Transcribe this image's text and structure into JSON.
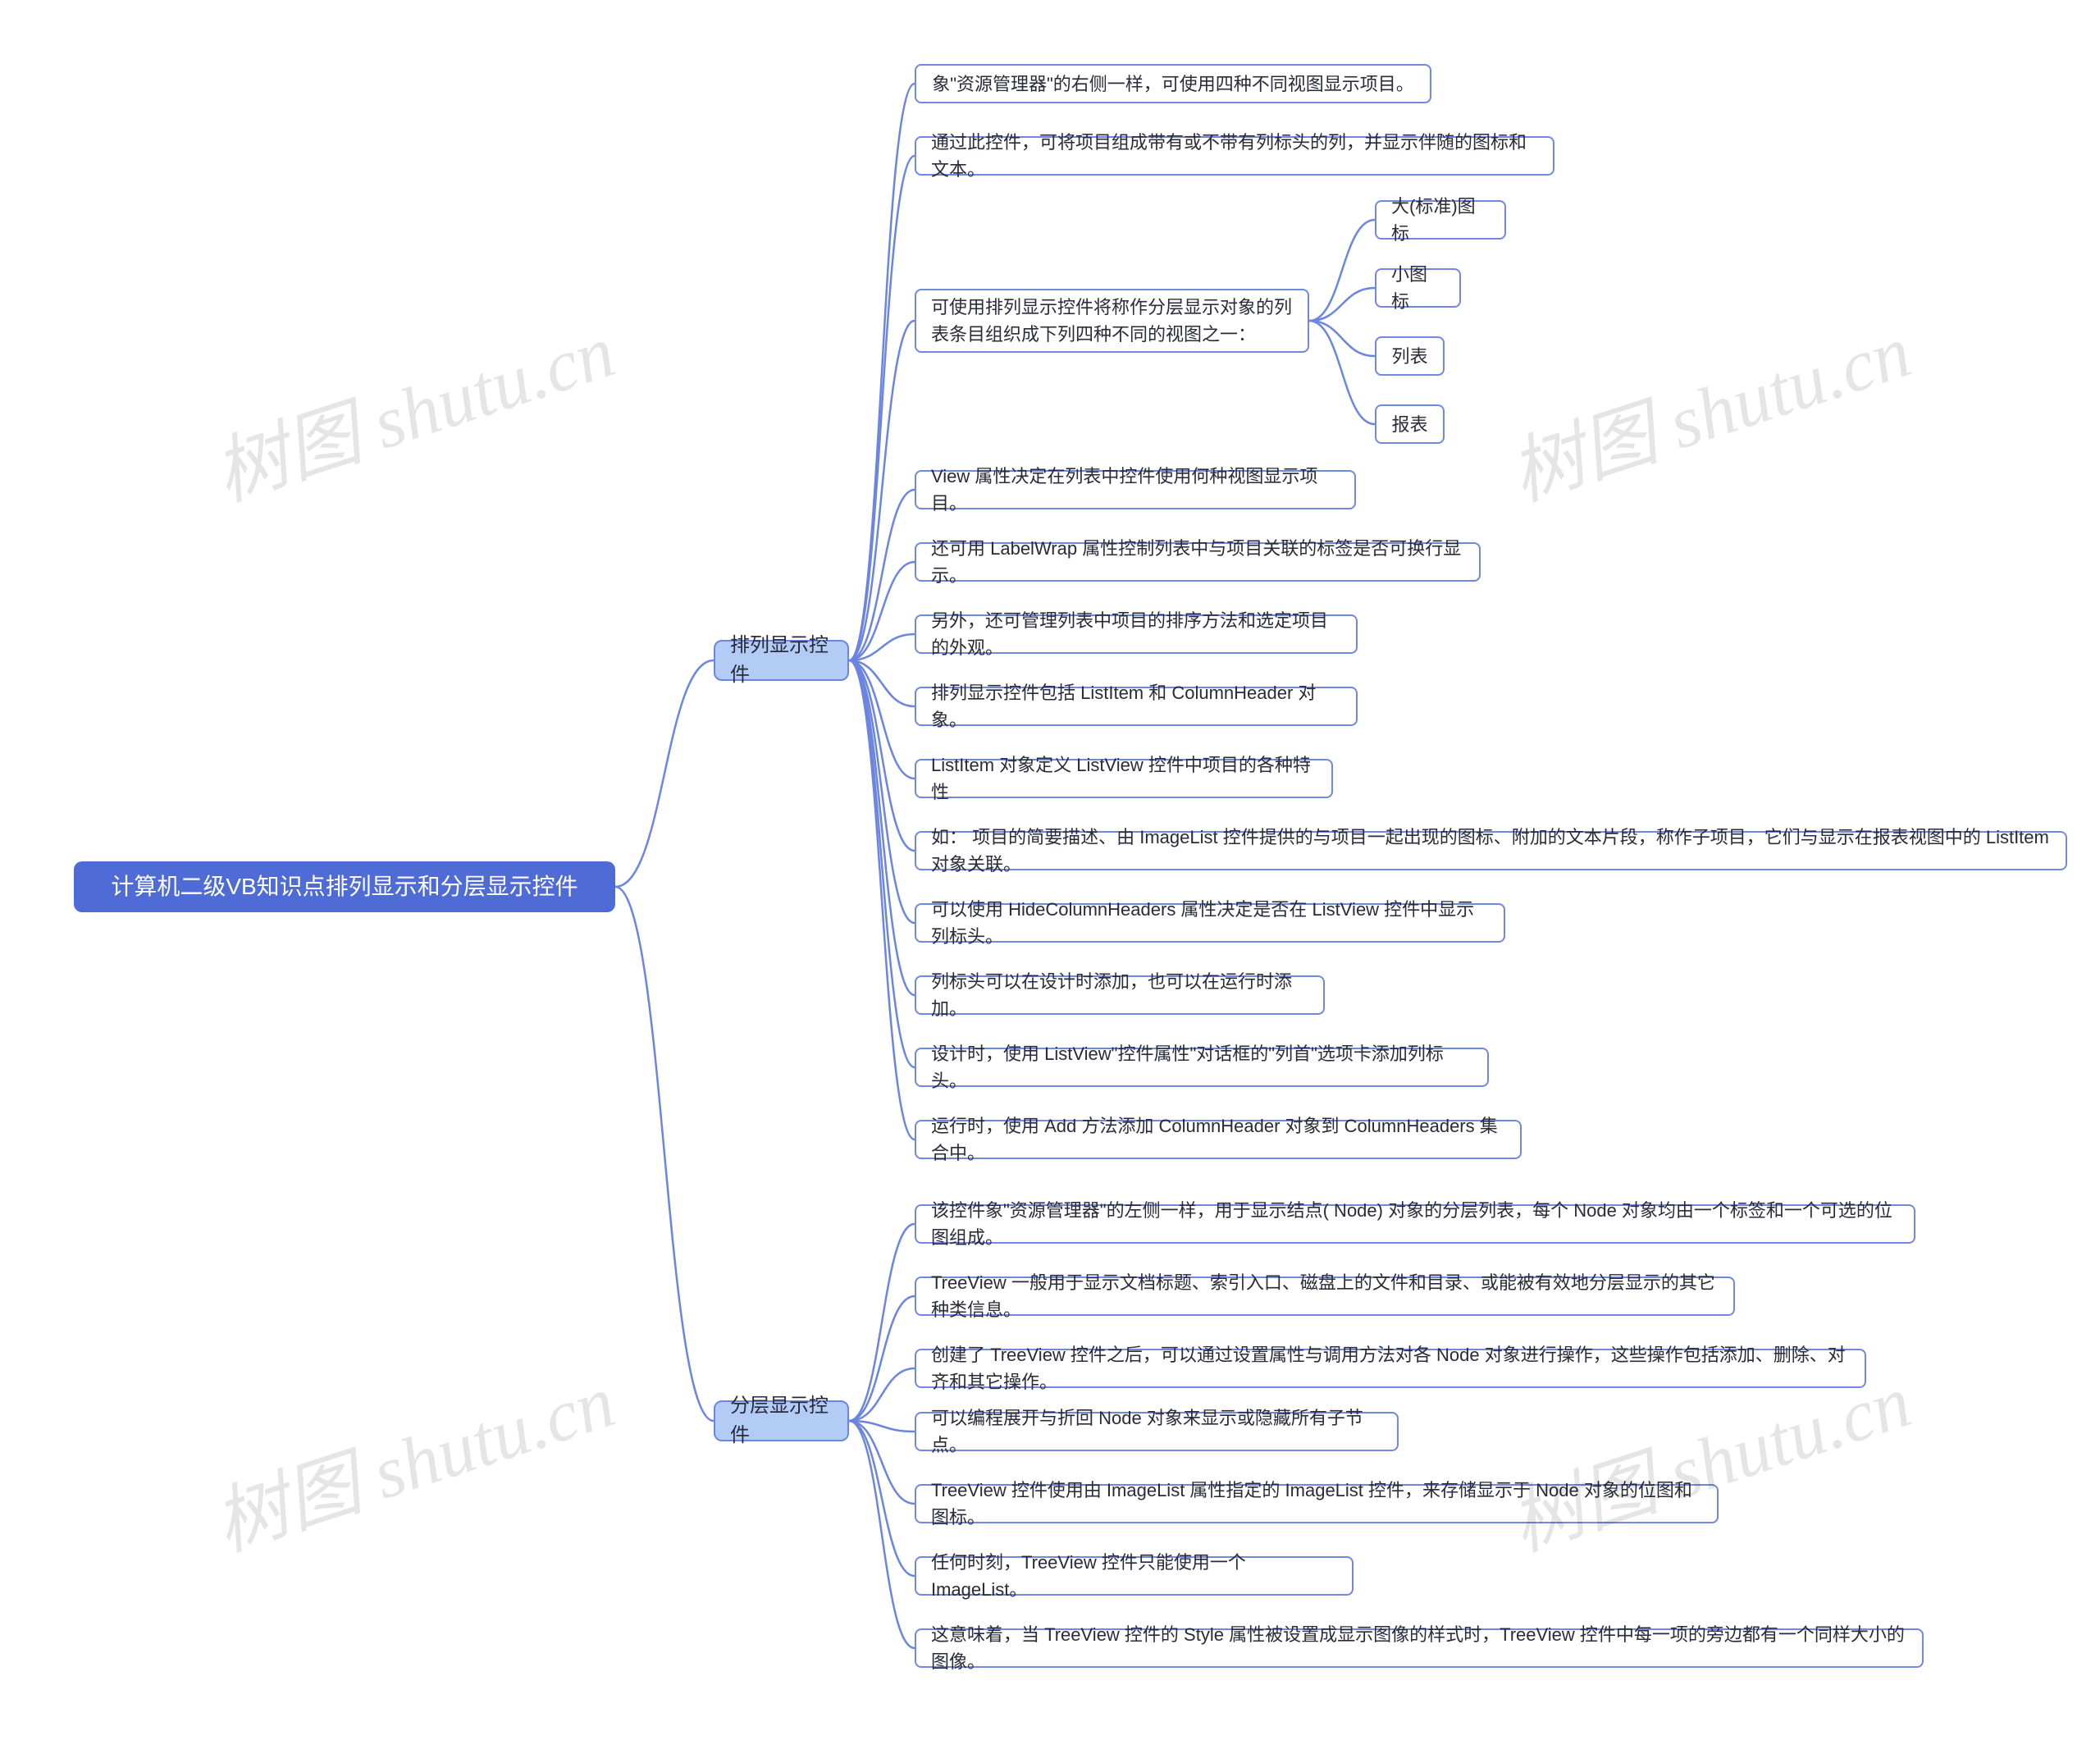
{
  "root": "计算机二级VB知识点排列显示和分层显示控件",
  "branches": {
    "b1": "排列显示控件",
    "b2": "分层显示控件"
  },
  "b1_children": {
    "c1": "象\"资源管理器\"的右侧一样，可使用四种不同视图显示项目。",
    "c2": "通过此控件，可将项目组成带有或不带有列标头的列，并显示伴随的图标和文本。",
    "c3": "可使用排列显示控件将称作分层显示对象的列表条目组织成下列四种不同的视图之一：",
    "c4": "View 属性决定在列表中控件使用何种视图显示项目。",
    "c5": "还可用 LabelWrap 属性控制列表中与项目关联的标签是否可换行显示。",
    "c6": "另外，还可管理列表中项目的排序方法和选定项目的外观。",
    "c7": "排列显示控件包括 ListItem 和 ColumnHeader 对象。",
    "c8": "ListItem 对象定义 ListView 控件中项目的各种特性",
    "c9": "如： 项目的简要描述、由 ImageList 控件提供的与项目一起出现的图标、附加的文本片段，称作子项目，它们与显示在报表视图中的 ListItem 对象关联。",
    "c10": "可以使用 HideColumnHeaders 属性决定是否在 ListView 控件中显示列标头。",
    "c11": "列标头可以在设计时添加，也可以在运行时添加。",
    "c12": "设计时，使用 ListView\"控件属性\"对话框的\"列首\"选项卡添加列标头。",
    "c13": "运行时，使用 Add 方法添加 ColumnHeader 对象到 ColumnHeaders 集合中。"
  },
  "c3_children": {
    "v1": "大(标准)图标",
    "v2": "小图标",
    "v3": "列表",
    "v4": "报表"
  },
  "b2_children": {
    "d1": "该控件象\"资源管理器\"的左侧一样，用于显示结点( Node) 对象的分层列表，每个 Node 对象均由一个标签和一个可选的位图组成。",
    "d2": "TreeView 一般用于显示文档标题、索引入口、磁盘上的文件和目录、或能被有效地分层显示的其它种类信息。",
    "d3": "创建了 TreeView 控件之后，可以通过设置属性与调用方法对各 Node 对象进行操作，这些操作包括添加、删除、对齐和其它操作。",
    "d4": "可以编程展开与折回 Node 对象来显示或隐藏所有子节点。",
    "d5": "TreeView 控件使用由 ImageList 属性指定的 ImageList 控件，来存储显示于 Node 对象的位图和图标。",
    "d6": "任何时刻，TreeView 控件只能使用一个 ImageList。",
    "d7": "这意味着，当 TreeView 控件的 Style 属性被设置成显示图像的样式时，TreeView 控件中每一项的旁边都有一个同样大小的图像。"
  },
  "watermarks": {
    "w1": "树图 shutu.cn",
    "w2": "树图 shutu.cn",
    "w3": "树图 shutu.cn",
    "w4": "树图 shutu.cn"
  }
}
